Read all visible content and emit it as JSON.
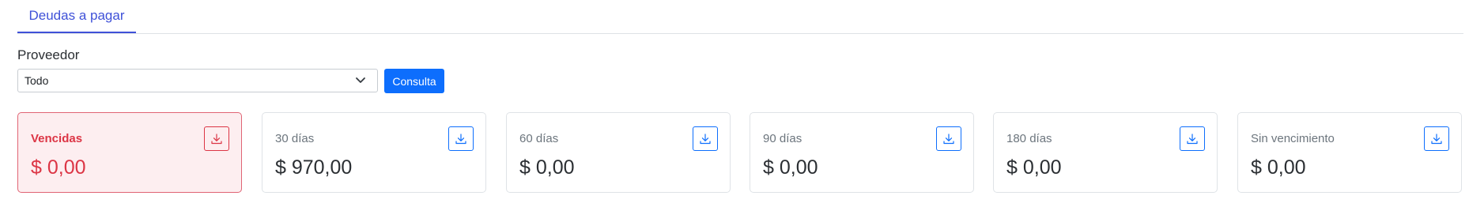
{
  "tabs": [
    {
      "label": "Deudas a pagar",
      "active": true
    }
  ],
  "filter": {
    "label": "Proveedor",
    "selected": "Todo",
    "button_label": "Consulta"
  },
  "cards": [
    {
      "title": "Vencidas",
      "amount": "$ 0,00",
      "status": "danger",
      "icon": "download-icon"
    },
    {
      "title": "30 días",
      "amount": "$ 970,00",
      "status": "normal",
      "icon": "download-icon"
    },
    {
      "title": "60 días",
      "amount": "$ 0,00",
      "status": "normal",
      "icon": "download-icon"
    },
    {
      "title": "90 días",
      "amount": "$ 0,00",
      "status": "normal",
      "icon": "download-icon"
    },
    {
      "title": "180 días",
      "amount": "$ 0,00",
      "status": "normal",
      "icon": "download-icon"
    },
    {
      "title": "Sin vencimiento",
      "amount": "$ 0,00",
      "status": "normal",
      "icon": "download-icon"
    }
  ],
  "colors": {
    "primary": "#0d6efd",
    "danger": "#dc3545",
    "tab_accent": "#3f51d8"
  }
}
